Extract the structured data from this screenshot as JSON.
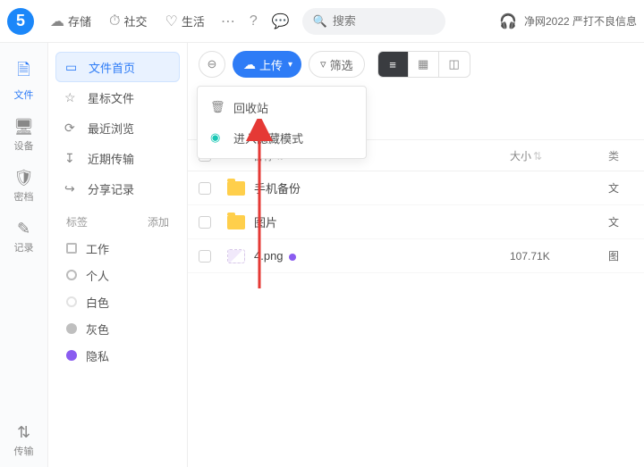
{
  "top": {
    "logo": "5",
    "tabs": [
      {
        "icon": "☁",
        "label": "存储"
      },
      {
        "icon": "⏱",
        "label": "社交"
      },
      {
        "icon": "♡",
        "label": "生活"
      }
    ],
    "search_placeholder": "搜索",
    "notice": "净网2022 严打不良信息"
  },
  "rail": [
    {
      "icon": "🗎",
      "label": "文件",
      "active": true
    },
    {
      "icon": "🖥",
      "label": "设备"
    },
    {
      "icon": "🛡",
      "label": "密档"
    },
    {
      "icon": "✎",
      "label": "记录"
    }
  ],
  "rail_bottom": {
    "icon": "⇅",
    "label": "传输"
  },
  "sidebar": {
    "items": [
      {
        "icon": "▭",
        "label": "文件首页",
        "active": true
      },
      {
        "icon": "☆",
        "label": "星标文件"
      },
      {
        "icon": "⟳",
        "label": "最近浏览"
      },
      {
        "icon": "↧",
        "label": "近期传输"
      },
      {
        "icon": "↪",
        "label": "分享记录"
      }
    ],
    "tags_label": "标签",
    "add_label": "添加",
    "tags": [
      {
        "shape": "square",
        "color": "#bbb",
        "label": "工作"
      },
      {
        "shape": "circle",
        "color": "#bbb",
        "label": "个人"
      },
      {
        "shape": "circle",
        "color": "#ddd",
        "label": "白色"
      },
      {
        "shape": "dot",
        "color": "#bfbfbf",
        "label": "灰色"
      },
      {
        "shape": "dot",
        "color": "#8a5cf0",
        "label": "隐私"
      }
    ]
  },
  "toolbar": {
    "upload_label": "上传",
    "filter_label": "筛选"
  },
  "dropdown": [
    {
      "icon": "🗑",
      "label": "回收站",
      "teal": false
    },
    {
      "icon": "◉",
      "label": "进入隐藏模式",
      "teal": true
    }
  ],
  "columns": {
    "name": "名称",
    "size": "大小",
    "type": "类"
  },
  "rows": [
    {
      "kind": "folder",
      "name": "手机备份",
      "size": "",
      "type": "文"
    },
    {
      "kind": "folder",
      "name": "图片",
      "size": "",
      "type": "文"
    },
    {
      "kind": "png",
      "name": "4.png",
      "tagged": true,
      "size": "107.71K",
      "type": "图"
    }
  ]
}
